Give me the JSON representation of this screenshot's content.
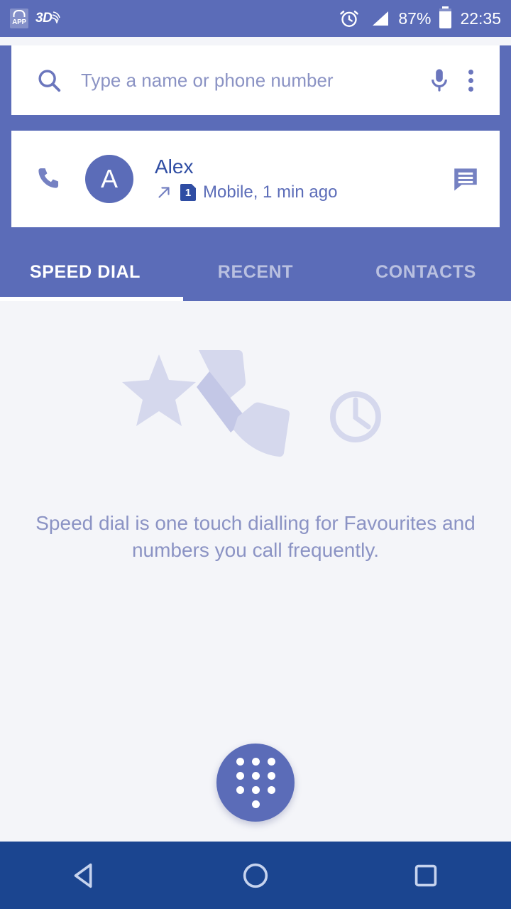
{
  "status_bar": {
    "app_badge_label": "APP",
    "threed_label": "3D",
    "battery_percent": "87%",
    "time": "22:35",
    "icons": [
      "app-shop-icon",
      "3d-signal-icon",
      "alarm-clock-icon",
      "signal-bars-icon",
      "battery-icon"
    ]
  },
  "search": {
    "placeholder": "Type a name or phone number",
    "value": "",
    "search_icon": "search-icon",
    "mic_icon": "microphone-icon",
    "overflow_icon": "overflow-menu-icon"
  },
  "contact": {
    "call_icon": "phone-call-icon",
    "avatar_initial": "A",
    "name": "Alex",
    "direction_icon": "outgoing-call-arrow-icon",
    "sim_badge": "1",
    "detail": "Mobile, 1 min ago",
    "message_icon": "message-bubble-icon"
  },
  "tabs": [
    {
      "label": "SPEED DIAL",
      "active": true
    },
    {
      "label": "RECENT",
      "active": false
    },
    {
      "label": "CONTACTS",
      "active": false
    }
  ],
  "empty_state": {
    "illustration_icons": [
      "star-icon",
      "phone-handset-icon",
      "clock-icon"
    ],
    "message": "Speed dial is one touch dialling for Favourites and numbers you call frequently."
  },
  "fab": {
    "icon": "dialpad-icon",
    "label": "Dialpad"
  },
  "navbar": {
    "back_label": "Back",
    "home_label": "Home",
    "recents_label": "Recents"
  },
  "colors": {
    "header_blue": "#5b6cb8",
    "navbar_blue": "#1b4590",
    "content_bg": "#f4f5f9",
    "accent_text": "#2f4da3",
    "muted_text": "#8b93c4",
    "illustration_light": "#d5d8ed",
    "illustration_dark": "#c3c7e6"
  }
}
